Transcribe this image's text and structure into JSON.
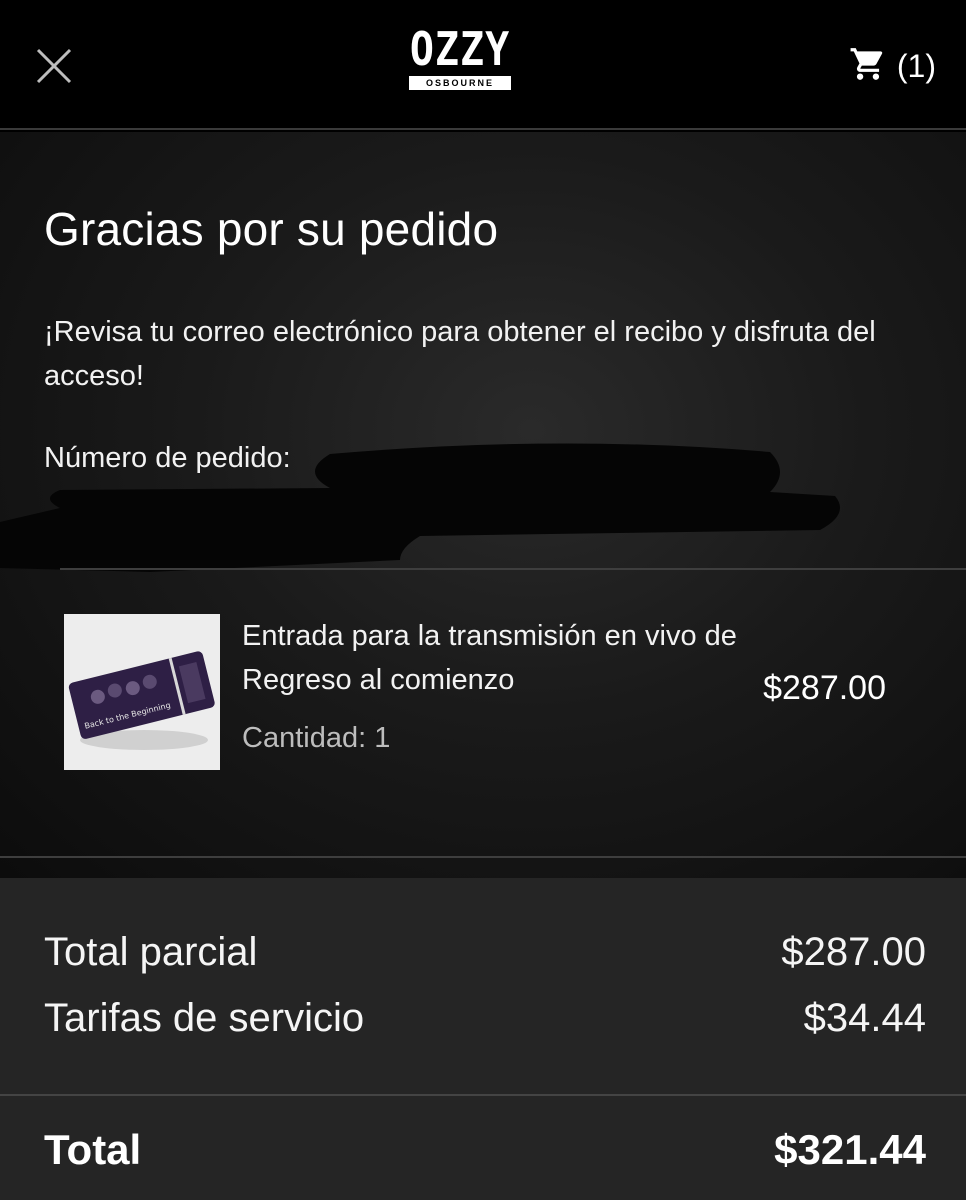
{
  "header": {
    "logo_main": "OZZY",
    "logo_sub": "OSBOURNE",
    "cart_count": "(1)"
  },
  "confirmation": {
    "title": "Gracias por su pedido",
    "message": "¡Revisa tu correo electrónico para obtener el recibo y disfruta del acceso!",
    "order_number_label": "Número de pedido:"
  },
  "item": {
    "name": "Entrada para la transmisión en vivo de Regreso al comienzo",
    "quantity_label": "Cantidad:  1",
    "price": "$287.00",
    "ticket_text": "Back to the Beginning"
  },
  "summary": {
    "subtotal_label": "Total parcial",
    "subtotal_value": "$287.00",
    "fees_label": "Tarifas de servicio",
    "fees_value": "$34.44",
    "total_label": "Total",
    "total_value": "$321.44"
  },
  "colors": {
    "background": "#000000",
    "panel": "#252525",
    "ticket": "#2e1f45"
  }
}
